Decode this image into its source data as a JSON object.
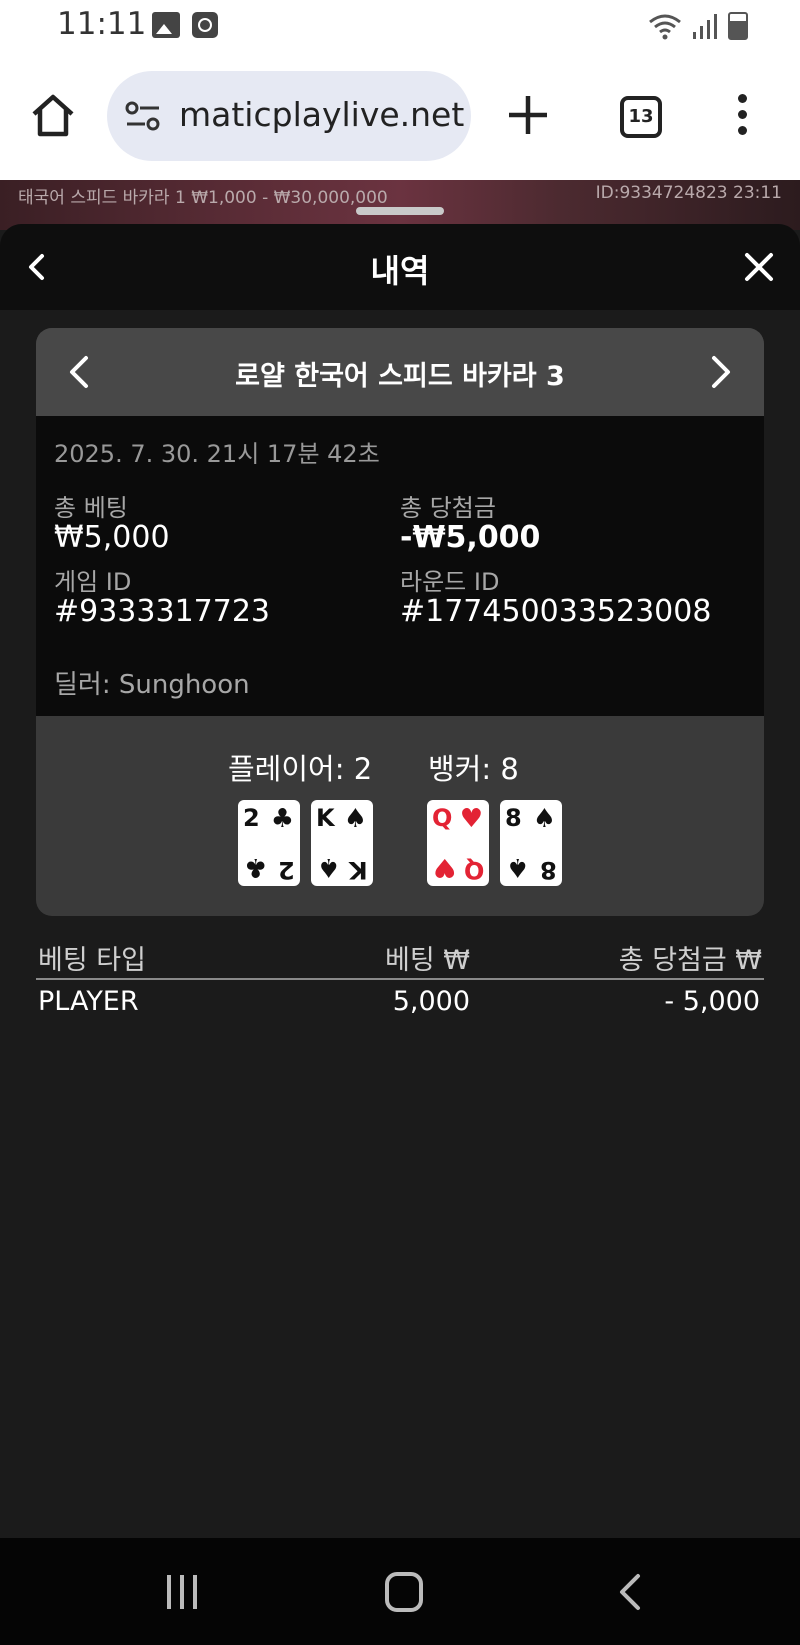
{
  "status_bar": {
    "time": "11:11"
  },
  "browser": {
    "url_text": "maticplaylive.net",
    "tabs_count": "13"
  },
  "background_game": {
    "left_text": "태국어 스피드 바카라 1 ₩1,000 - ₩30,000,000",
    "right_text": "ID:9334724823  23:11"
  },
  "sheet": {
    "title": "내역"
  },
  "round": {
    "table_name": "로얄 한국어 스피드 바카라 3",
    "datetime": "2025. 7. 30. 21시 17분 42초",
    "total_bet_label": "총 베팅",
    "total_bet_value": "₩5,000",
    "total_win_label": "총 당첨금",
    "total_win_value": "-₩5,000",
    "game_id_label": "게임 ID",
    "game_id_value": "#9333317723",
    "round_id_label": "라운드 ID",
    "round_id_value": "#177450033523008",
    "dealer": "딜러: Sunghoon",
    "player_label": "플레이어: 2",
    "banker_label": "뱅커: 8",
    "player_cards": [
      {
        "rank": "2",
        "suit": "♣",
        "color": "#111111"
      },
      {
        "rank": "K",
        "suit": "♠",
        "color": "#111111"
      }
    ],
    "banker_cards": [
      {
        "rank": "Q",
        "suit": "♥",
        "color": "#e32334"
      },
      {
        "rank": "8",
        "suit": "♠",
        "color": "#111111"
      }
    ]
  },
  "bet_table": {
    "headers": {
      "type": "베팅 타입",
      "bet": "베팅 ₩",
      "win": "총 당첨금 ₩"
    },
    "rows": [
      {
        "type": "PLAYER",
        "bet": "5,000",
        "win": "- 5,000"
      }
    ]
  }
}
